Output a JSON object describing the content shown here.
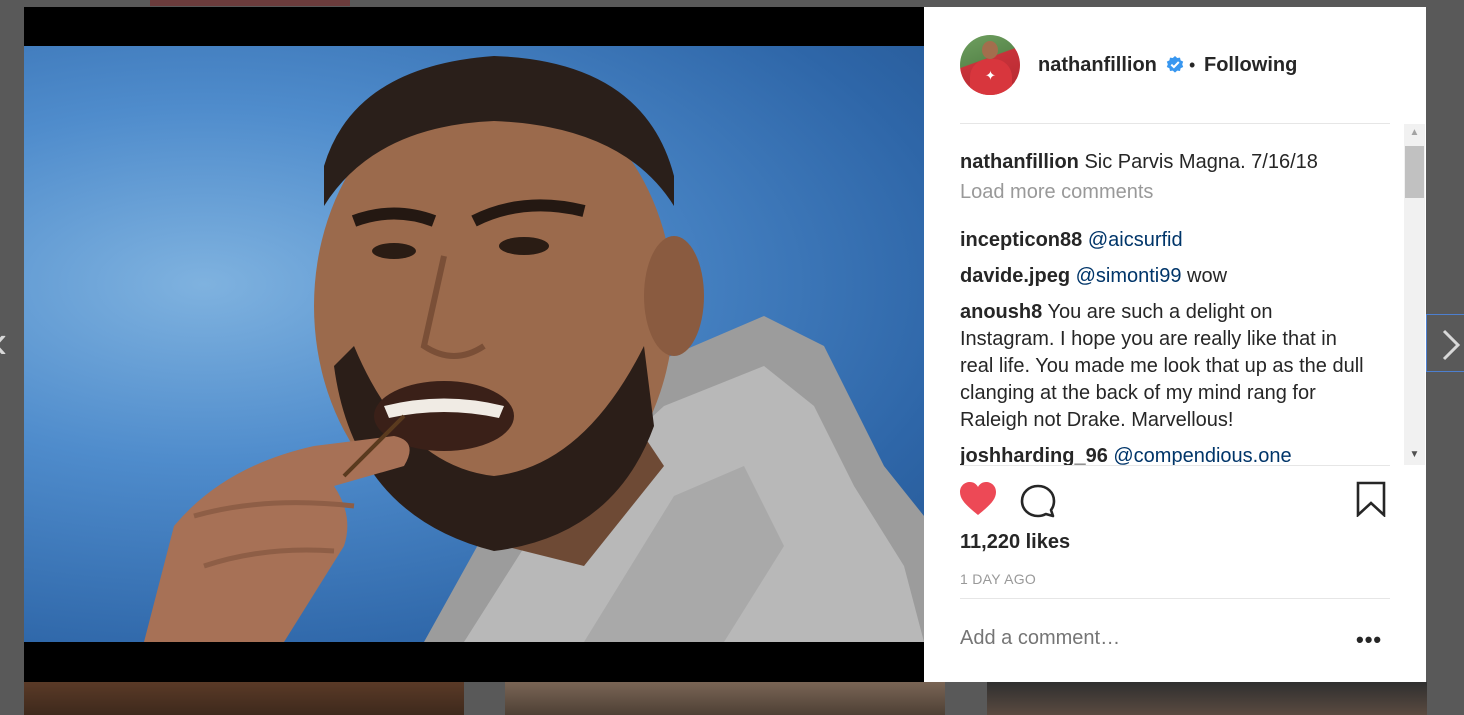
{
  "post": {
    "username": "nathanfillion",
    "separator": "•",
    "follow_status": "Following",
    "caption": "Sic Parvis Magna. 7/16/18",
    "load_more_label": "Load more comments",
    "likes": "11,220 likes",
    "timestamp": "1 DAY AGO",
    "add_comment_placeholder": "Add a comment…",
    "more_label": "•••",
    "liked": true
  },
  "comments": [
    {
      "user": "incepticon88",
      "mention": "@aicsurfid",
      "text": ""
    },
    {
      "user": "davide.jpeg",
      "mention": "@simonti99",
      "text": " wow"
    },
    {
      "user": "anoush8",
      "mention": "",
      "text": " You are such a delight on Instagram. I hope you are really like that in real life. You made me look that up as the dull clanging at the back of my mind rang for Raleigh not Drake. Marvellous!"
    },
    {
      "user": "joshharding_96",
      "mention": "@compendious.one",
      "text": ""
    }
  ],
  "icons": {
    "verified": "verified-badge-icon",
    "heart": "heart-icon",
    "comment": "comment-icon",
    "bookmark": "bookmark-icon",
    "prev": "chevron-left-icon",
    "next": "chevron-right-icon"
  },
  "colors": {
    "heart": "#ed4956",
    "verified": "#3897f0",
    "mention": "#003569",
    "muted": "#999999",
    "text": "#262626"
  }
}
